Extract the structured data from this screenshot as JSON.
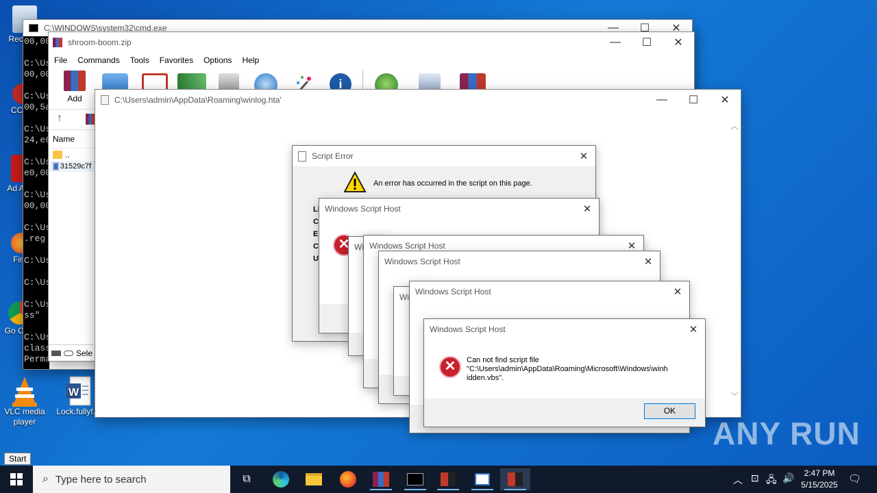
{
  "desktop": {
    "icons": [
      {
        "label": "Recy"
      },
      {
        "label": "CCl"
      },
      {
        "label": "Ad Ac"
      },
      {
        "label": "Fir"
      },
      {
        "label": "Go Chr"
      },
      {
        "label": "VLC media player"
      },
      {
        "label": "Lock.fullyf..."
      }
    ],
    "start_tooltip": "Start"
  },
  "cmd": {
    "title": "C:\\WINDOWS\\system32\\cmd.exe",
    "lines": [
      "00,00",
      "",
      "C:\\Us",
      "00,00",
      "",
      "C:\\Us",
      "00,5a",
      "",
      "C:\\Us",
      "24,e6",
      "",
      "C:\\Us",
      "e0,00",
      "",
      "C:\\Us",
      "00,00",
      "",
      "C:\\Us",
      ".reg",
      "",
      "C:\\Us",
      "",
      "C:\\Us",
      "",
      "C:\\Us",
      "ss\"",
      "",
      "C:\\Us",
      "class",
      "Permanently d"
    ]
  },
  "winrar": {
    "title": "shroom-boom.zip",
    "menu": [
      "File",
      "Commands",
      "Tools",
      "Favorites",
      "Options",
      "Help"
    ],
    "add_label": "Add",
    "column_name": "Name",
    "files": [
      "..",
      "31529c7f"
    ],
    "status": "Sele"
  },
  "hta": {
    "title": "C:\\Users\\admin\\AppData\\Roaming\\winlog.hta'"
  },
  "script_error": {
    "title": "Script Error",
    "message": "An error has occurred in the script on this page.",
    "fields": [
      "Li",
      "Ch",
      "Er",
      "Co",
      "UR"
    ]
  },
  "wsh": {
    "title": "Windows Script Host",
    "partial_title": "Wi",
    "message_line1": "Can not find script file",
    "message_line2": "\"C:\\Users\\admin\\AppData\\Roaming\\Microsoft\\Windows\\winh",
    "message_line3": "idden.vbs\".",
    "ok_label": "OK"
  },
  "taskbar": {
    "search_placeholder": "Type here to search",
    "time": "2:47 PM",
    "date": "5/15/2025"
  },
  "watermark": "ANY RUN",
  "colors": {
    "accent": "#0078d7",
    "error_red": "#c8202c",
    "taskbar": "#101a2b"
  }
}
